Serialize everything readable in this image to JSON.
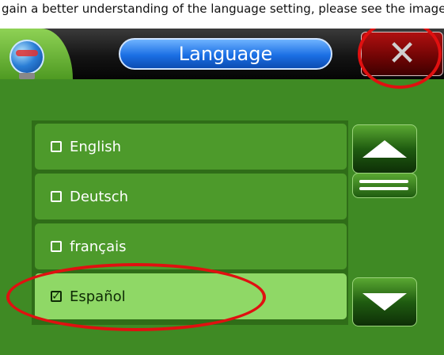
{
  "top_caption": "gain a better understanding of the language setting, please see the image below:",
  "window": {
    "title": "Language",
    "close_label": "✕"
  },
  "languages": [
    {
      "label": "English",
      "checked": false
    },
    {
      "label": "Deutsch",
      "checked": false
    },
    {
      "label": "français",
      "checked": false
    },
    {
      "label": "Español",
      "checked": true
    }
  ],
  "icons": {
    "globe": "globe-icon",
    "close": "close-icon",
    "up": "up-arrow-icon",
    "down": "down-arrow-icon",
    "scroll": "scroll-thumb-icon"
  },
  "colors": {
    "accent_green": "#3f8a24",
    "selected_green": "#8fd866",
    "title_blue": "#1b6fe4",
    "close_red": "#b01010",
    "annotation_red": "#e01010"
  }
}
